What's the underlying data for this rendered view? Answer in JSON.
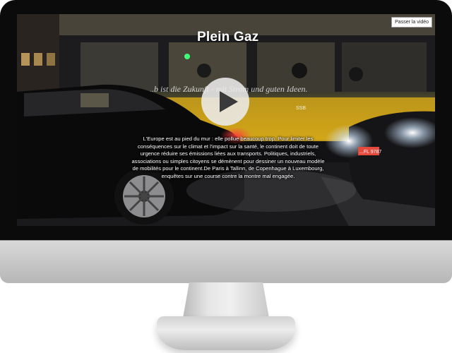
{
  "video": {
    "title": "Plein Gaz",
    "skip_label": "Passer la vidéo",
    "description": "L'Europe est au pied du mur : elle pollue beaucoup trop. Pour limiter les conséquences sur le climat et l'impact sur la santé, le continent doit de toute urgence réduire ses émissions liées aux transports. Politiques, industriels, associations ou simples citoyens se démènent pour dessiner un nouveau modèle de mobilités pour le continent.De Paris à Tallinn, de Copenhague à Luxembourg, enquêtes sur une course contre la montre mal engagée.",
    "play_icon": "play-icon"
  },
  "scene": {
    "bus_slogan": "...b ist die Zukunft - mit Strom und guten Ideen.",
    "bus_brand": "SSB",
    "license_plate": "...FL 9787"
  },
  "colors": {
    "bus_yellow": "#e0b21e",
    "bezel": "#0b0b0b",
    "monitor_silver": "#cfcfcf"
  }
}
